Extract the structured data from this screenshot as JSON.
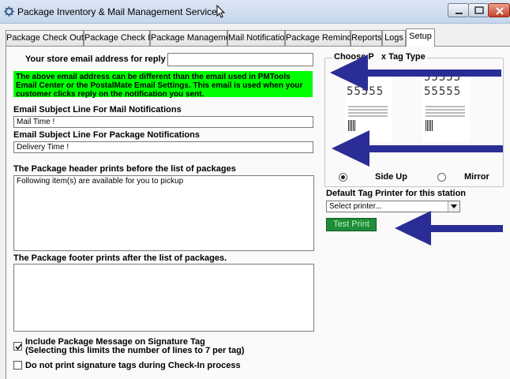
{
  "window": {
    "title": "Package Inventory & Mail Management Service",
    "icons": {
      "app": "gear-icon",
      "minimize": "minimize-icon",
      "maximize": "maximize-icon",
      "close": "close-icon"
    }
  },
  "tabs": [
    {
      "label": "Package Check Out",
      "active": false
    },
    {
      "label": "Package Check In",
      "active": false
    },
    {
      "label": "Package Management",
      "active": false
    },
    {
      "label": "Mail Notification",
      "active": false
    },
    {
      "label": "Package Reminder",
      "active": false
    },
    {
      "label": "Reports",
      "active": false
    },
    {
      "label": "Logs",
      "active": false
    },
    {
      "label": "Setup",
      "active": true
    }
  ],
  "setup": {
    "reply_email_label": "Your store email address for reply to:",
    "reply_email_value": "",
    "reply_email_note": "The above email address can be different than the email used in PMTools Email Center or the PostalMate Email Settings. This email is used when your customer clicks reply on the notification you sent.",
    "mail_subject_label": "Email Subject Line For Mail Notifications",
    "mail_subject_value": "Mail Time !",
    "package_subject_label": "Email Subject Line For Package Notifications",
    "package_subject_value": "Delivery Time !",
    "header_label": "The Package header prints before the list of packages",
    "header_value": "Following item(s) are available for you to pickup",
    "footer_label": "The Package footer prints after the list of packages.",
    "footer_value": "",
    "include_msg_line1": "Include Package Message on Signature Tag",
    "include_msg_line2": "(Selecting this limits the number of lines to 7 per tag)",
    "include_msg_checked": true,
    "no_print_label": "Do not print signature tags during Check-In process",
    "no_print_checked": false
  },
  "tag_type": {
    "group_label": "Choose Print Tag Type",
    "group_label_visible": "Choose P   x Tag Type",
    "sample_left_top": "555",
    "sample_left_main": "55555",
    "sample_right_top": "55555",
    "sample_right_main": "55555",
    "option_side_up": "Side Up",
    "option_mirror": "Mirror",
    "selected": "side_up"
  },
  "printer": {
    "label": "Default Tag Printer for this station",
    "selected": "Select printer...",
    "test_print_label": "Test Print"
  },
  "colors": {
    "note_bg": "#00ff00",
    "test_print_bg": "#1f8c3a",
    "arrow": "#2b2d96"
  }
}
